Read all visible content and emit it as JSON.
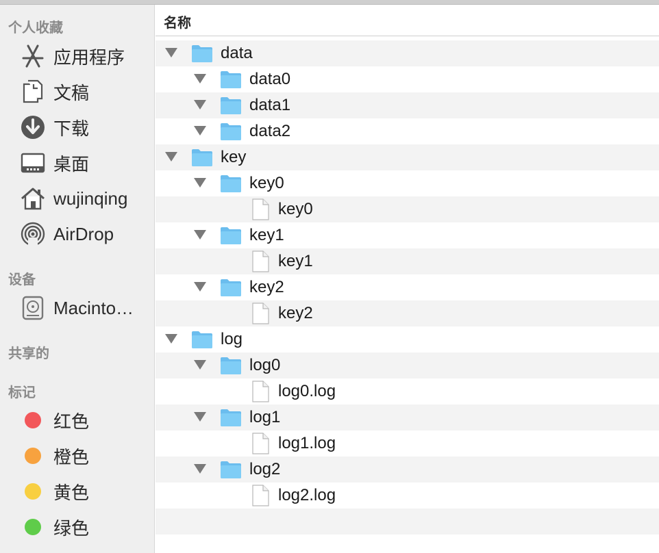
{
  "sidebar": {
    "favorites_title": "个人收藏",
    "favorites": [
      {
        "label": "应用程序",
        "icon": "applications-icon"
      },
      {
        "label": "文稿",
        "icon": "documents-icon"
      },
      {
        "label": "下载",
        "icon": "downloads-icon"
      },
      {
        "label": "桌面",
        "icon": "desktop-icon"
      },
      {
        "label": "wujinqing",
        "icon": "home-icon"
      },
      {
        "label": "AirDrop",
        "icon": "airdrop-icon"
      }
    ],
    "devices_title": "设备",
    "devices": [
      {
        "label": "Macinto…",
        "icon": "hard-drive-icon"
      }
    ],
    "shared_title": "共享的",
    "tags_title": "标记",
    "tags": [
      {
        "label": "红色",
        "color": "#f2575a"
      },
      {
        "label": "橙色",
        "color": "#f7a23f"
      },
      {
        "label": "黄色",
        "color": "#f8cf41"
      },
      {
        "label": "绿色",
        "color": "#5fcc4a"
      }
    ]
  },
  "main": {
    "column_header": "名称",
    "rows": [
      {
        "name": "data",
        "type": "folder",
        "level": 0,
        "expanded": true
      },
      {
        "name": "data0",
        "type": "folder",
        "level": 1,
        "expanded": true
      },
      {
        "name": "data1",
        "type": "folder",
        "level": 1,
        "expanded": true
      },
      {
        "name": "data2",
        "type": "folder",
        "level": 1,
        "expanded": true
      },
      {
        "name": "key",
        "type": "folder",
        "level": 0,
        "expanded": true
      },
      {
        "name": "key0",
        "type": "folder",
        "level": 1,
        "expanded": true
      },
      {
        "name": "key0",
        "type": "file",
        "level": 2
      },
      {
        "name": "key1",
        "type": "folder",
        "level": 1,
        "expanded": true
      },
      {
        "name": "key1",
        "type": "file",
        "level": 2
      },
      {
        "name": "key2",
        "type": "folder",
        "level": 1,
        "expanded": true
      },
      {
        "name": "key2",
        "type": "file",
        "level": 2
      },
      {
        "name": "log",
        "type": "folder",
        "level": 0,
        "expanded": true
      },
      {
        "name": "log0",
        "type": "folder",
        "level": 1,
        "expanded": true
      },
      {
        "name": "log0.log",
        "type": "file",
        "level": 2
      },
      {
        "name": "log1",
        "type": "folder",
        "level": 1,
        "expanded": true
      },
      {
        "name": "log1.log",
        "type": "file",
        "level": 2
      },
      {
        "name": "log2",
        "type": "folder",
        "level": 1,
        "expanded": true
      },
      {
        "name": "log2.log",
        "type": "file",
        "level": 2
      }
    ]
  },
  "colors": {
    "folder": "#7fcdf6",
    "folder_tab": "#6bbdee",
    "sidebar_bg": "#efefef",
    "stripe": "#f3f3f3"
  }
}
